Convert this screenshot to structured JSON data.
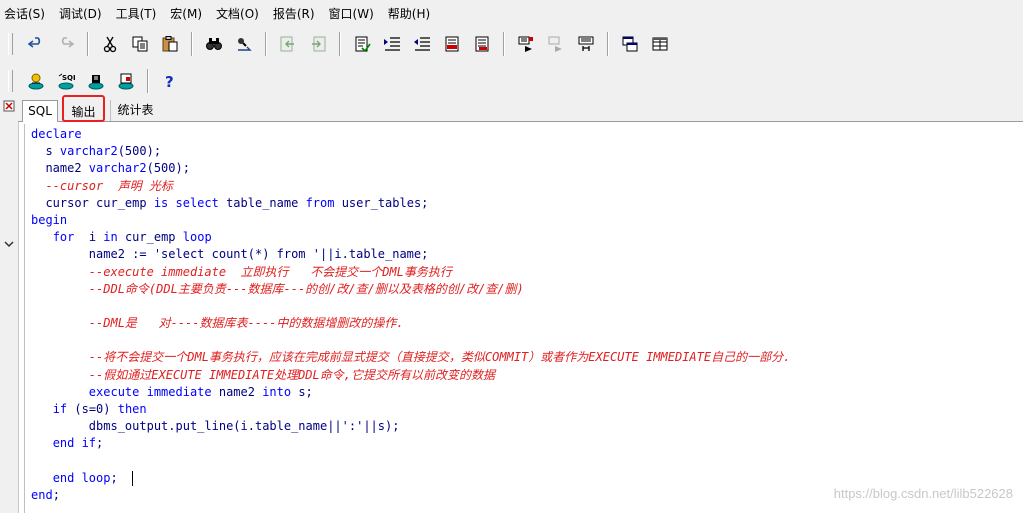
{
  "menu": {
    "items": [
      "会话(S)",
      "调试(D)",
      "工具(T)",
      "宏(M)",
      "文档(O)",
      "报告(R)",
      "窗口(W)",
      "帮助(H)"
    ]
  },
  "toolbar1": {
    "groups": [
      [
        "undo-icon",
        "redo-icon"
      ],
      [
        "cut-icon",
        "copy-icon",
        "paste-icon"
      ],
      [
        "find-icon",
        "find-next-icon"
      ],
      [
        "prev-icon",
        "next-icon"
      ],
      [
        "comment-icon",
        "indent-icon",
        "unindent-icon",
        "uppercase-icon",
        "lowercase-icon"
      ],
      [
        "execute-icon",
        "stop-icon",
        "explain-icon"
      ],
      [
        "windows-icon",
        "grid-icon"
      ]
    ]
  },
  "toolbar2": {
    "groups": [
      [
        "database-icon",
        "sql-window-icon",
        "command-window-icon",
        "report-icon"
      ],
      [
        "help-icon"
      ]
    ]
  },
  "tabs": {
    "sql": "SQL",
    "output": "输出",
    "stats": "统计表"
  },
  "colors": {
    "keyword": "#0000ff",
    "text": "#000080",
    "comment": "#e02020",
    "highlight_box": "#e8201f"
  },
  "code": [
    [
      {
        "t": "declare",
        "c": "kw"
      }
    ],
    [
      {
        "t": "  s ",
        "c": "tx"
      },
      {
        "t": "varchar2",
        "c": "kw"
      },
      {
        "t": "(500);",
        "c": "tx"
      }
    ],
    [
      {
        "t": "  name2 ",
        "c": "tx"
      },
      {
        "t": "varchar2",
        "c": "kw"
      },
      {
        "t": "(500);",
        "c": "tx"
      }
    ],
    [
      {
        "t": "  --cursor  声明 光标",
        "c": "cm"
      }
    ],
    [
      {
        "t": "  cursor cur_emp ",
        "c": "tx"
      },
      {
        "t": "is select",
        "c": "kw"
      },
      {
        "t": " table_name ",
        "c": "tx"
      },
      {
        "t": "from",
        "c": "kw"
      },
      {
        "t": " user_tables;",
        "c": "tx"
      }
    ],
    [
      {
        "t": "begin",
        "c": "kw"
      }
    ],
    [
      {
        "t": "   ",
        "c": "tx"
      },
      {
        "t": "for",
        "c": "kw"
      },
      {
        "t": "  i ",
        "c": "tx"
      },
      {
        "t": "in",
        "c": "kw"
      },
      {
        "t": " cur_emp ",
        "c": "tx"
      },
      {
        "t": "loop",
        "c": "kw"
      }
    ],
    [
      {
        "t": "        name2 := 'select count(*) from '||i.table_name;",
        "c": "tx"
      }
    ],
    [
      {
        "t": "        --execute immediate  立即执行   不会提交一个DML事务执行",
        "c": "cm"
      }
    ],
    [
      {
        "t": "        --DDL命令(DDL主要负责---数据库---的创/改/查/删以及表格的创/改/查/删)",
        "c": "cm"
      }
    ],
    [
      {
        "t": "",
        "c": "tx"
      }
    ],
    [
      {
        "t": "        --DML是   对----数据库表----中的数据增删改的操作.",
        "c": "cm"
      }
    ],
    [
      {
        "t": "",
        "c": "tx"
      }
    ],
    [
      {
        "t": "        --将不会提交一个DML事务执行，应该在完成前显式提交（直接提交，类似COMMIT）或者作为EXECUTE IMMEDIATE自己的一部分.",
        "c": "cm"
      }
    ],
    [
      {
        "t": "        --假如通过EXECUTE IMMEDIATE处理DDL命令,它提交所有以前改变的数据",
        "c": "cm"
      }
    ],
    [
      {
        "t": "        ",
        "c": "tx"
      },
      {
        "t": "execute immediate",
        "c": "kw"
      },
      {
        "t": " name2 ",
        "c": "tx"
      },
      {
        "t": "into",
        "c": "kw"
      },
      {
        "t": " s;",
        "c": "tx"
      }
    ],
    [
      {
        "t": "   ",
        "c": "tx"
      },
      {
        "t": "if",
        "c": "kw"
      },
      {
        "t": " (s=0) ",
        "c": "tx"
      },
      {
        "t": "then",
        "c": "kw"
      }
    ],
    [
      {
        "t": "        dbms_output.put_line(i.table_name||':'||s);",
        "c": "tx"
      }
    ],
    [
      {
        "t": "   ",
        "c": "tx"
      },
      {
        "t": "end if",
        "c": "kw"
      },
      {
        "t": ";",
        "c": "tx"
      }
    ],
    [
      {
        "t": "",
        "c": "tx"
      }
    ],
    [
      {
        "t": "   ",
        "c": "tx"
      },
      {
        "t": "end loop",
        "c": "kw"
      },
      {
        "t": ";",
        "c": "tx"
      }
    ],
    [
      {
        "t": "end",
        "c": "kw"
      },
      {
        "t": ";",
        "c": "tx"
      }
    ]
  ],
  "caret_line": 20,
  "watermark": "https://blog.csdn.net/lilb522628"
}
